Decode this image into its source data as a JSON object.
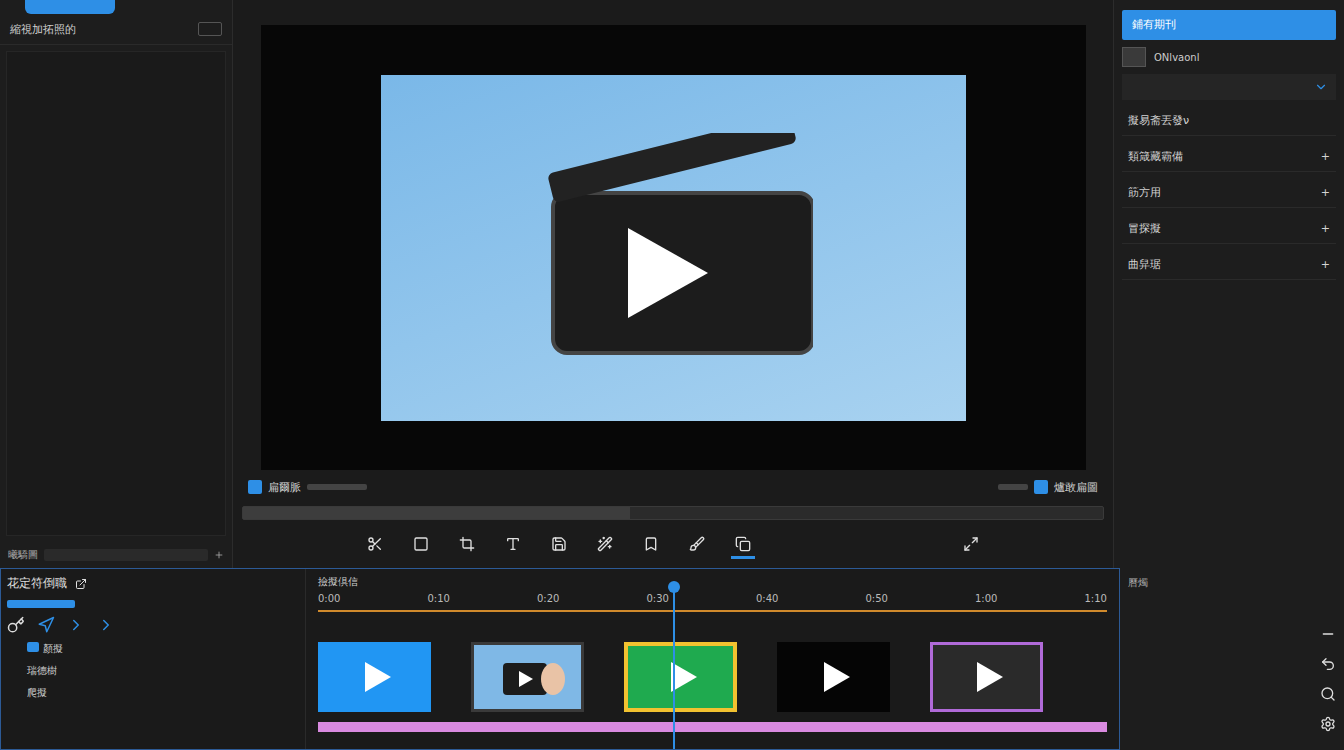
{
  "sidebar": {
    "title": "縮視加拓照的",
    "footer": "曦驕圖"
  },
  "preview": {
    "left_label": "扁爾脈",
    "right_label": "爐敢扁圖",
    "scrub_level": 0.45
  },
  "toolbar": [
    {
      "selected": false
    },
    {
      "selected": false
    },
    {
      "selected": false
    },
    {
      "selected": false
    },
    {
      "selected": false
    },
    {
      "selected": false
    },
    {
      "selected": false
    },
    {
      "selected": false
    },
    {
      "selected": true
    }
  ],
  "inspector": {
    "header": "鋪有期刊",
    "field": "ONlvaonl",
    "items": [
      {
        "label": "擬易斋丟發ν",
        "action": ""
      },
      {
        "label": "類箴藏霸備",
        "action": "+"
      },
      {
        "label": "筯方用",
        "action": "+"
      },
      {
        "label": "冒探擬",
        "action": "+"
      },
      {
        "label": "曲舁琚",
        "action": "+"
      }
    ]
  },
  "timeline": {
    "title": "花定符倒職",
    "ruler_title": "撿擬倶信",
    "ticks": [
      "0:00",
      "0:10",
      "0:20",
      "0:30",
      "0:40",
      "0:50",
      "1:00",
      "1:10"
    ],
    "labels": [
      "顏擬",
      "瑞德樹",
      "爬擬"
    ],
    "playhead": 0.45,
    "clips": [
      {
        "kind": "play",
        "color": "#2196f3",
        "accent": "#2196f3",
        "selected": false
      },
      {
        "kind": "photo",
        "color": "#7fb8e6",
        "accent": "#3a3a3a",
        "selected": false
      },
      {
        "kind": "play",
        "color": "#1faa4f",
        "accent": "#f2c230",
        "selected": true
      },
      {
        "kind": "play",
        "color": "#050505",
        "accent": "#050505",
        "selected": false
      },
      {
        "kind": "play",
        "color": "#2a2a2a",
        "accent": "#b06ad8",
        "selected": false
      }
    ],
    "audio_color": "#d98ae0"
  },
  "bottom_panel": {
    "label": "曆燭"
  }
}
